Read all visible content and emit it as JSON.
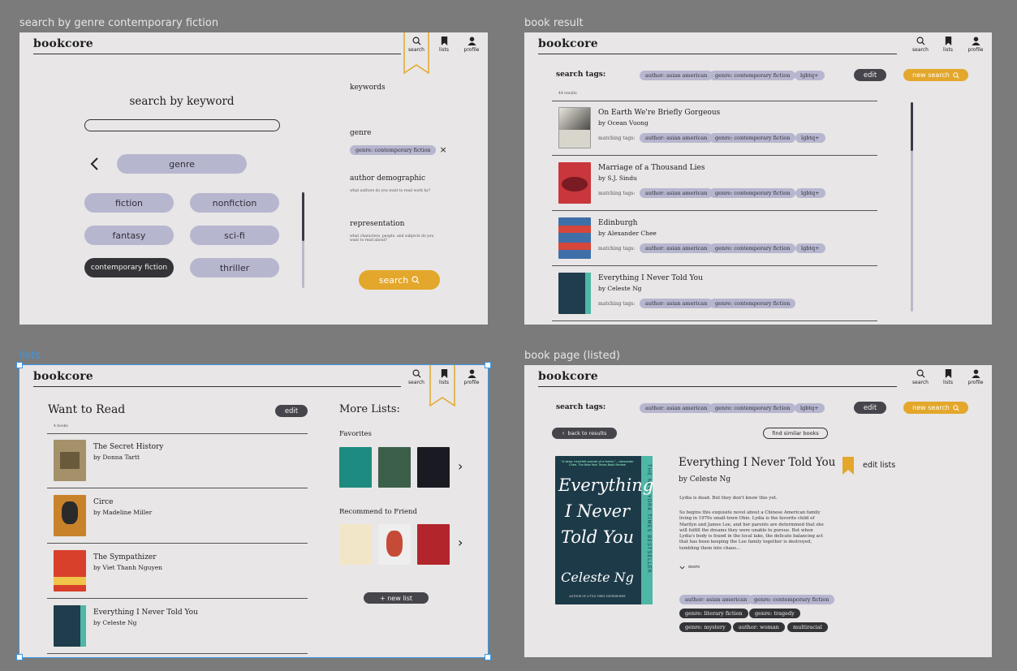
{
  "frames": {
    "search_genre_title": "search by genre contemporary fiction",
    "book_result_title": "book result",
    "lists_title": "lists",
    "book_page_title": "book page (listed)"
  },
  "app": {
    "logo": "bookcore"
  },
  "nav": {
    "search": "search",
    "lists": "lists",
    "profile": "profile"
  },
  "search_page": {
    "heading": "search by keyword",
    "genre_label": "genre",
    "genres": [
      "fiction",
      "nonfiction",
      "fantasy",
      "sci-fi",
      "contemporary fiction",
      "thriller"
    ],
    "selected_genre": "contemporary fiction",
    "keywords_label": "keywords",
    "genre_section_label": "genre",
    "genre_chip": "genre: contemporary fiction",
    "chip_remove": "×",
    "author_demo_label": "author demographic",
    "author_demo_hint": "what authors do you want to read work by?",
    "representation_label": "representation",
    "representation_hint": "what characters, people, and subjects do you want to read about?",
    "search_button": "search"
  },
  "results_page": {
    "search_tags_label": "search tags:",
    "tags": [
      "author: asian american",
      "genre: contemporary fiction",
      "lgbtq+"
    ],
    "edit": "edit",
    "new_search": "new search",
    "count": "44 results",
    "matching_label": "matching tags:",
    "books": [
      {
        "title": "On Earth We're Briefly Gorgeous",
        "author": "by Ocean Vuong",
        "tags": [
          "author: asian american",
          "genre: contemporary fiction",
          "lgbtq+"
        ],
        "color": "#d8d5cc"
      },
      {
        "title": "Marriage of a Thousand Lies",
        "author": "by S.J. Sindu",
        "tags": [
          "author: asian american",
          "genre: contemporary fiction",
          "lgbtq+"
        ],
        "color": "#c9363c"
      },
      {
        "title": "Edinburgh",
        "author": "by Alexander Chee",
        "tags": [
          "author: asian american",
          "genre: contemporary fiction",
          "lgbtq+"
        ],
        "color": "#3f6fa8"
      },
      {
        "title": "Everything I Never Told You",
        "author": "by Celeste Ng",
        "tags": [
          "author: asian american",
          "genre: contemporary fiction"
        ],
        "color": "#1f3d4c"
      }
    ]
  },
  "lists_page": {
    "title": "Want to Read",
    "edit": "edit",
    "count": "4 books",
    "books": [
      {
        "title": "The Secret History",
        "author": "by Donna Tartt",
        "color": "#a4916a"
      },
      {
        "title": "Circe",
        "author": "by Madeline Miller",
        "color": "#c8822a"
      },
      {
        "title": "The Sympathizer",
        "author": "by Viet Thanh Nguyen",
        "color": "#d8402b"
      },
      {
        "title": "Everything I Never Told You",
        "author": "by Celeste Ng",
        "color": "#1f3d4c"
      }
    ],
    "more_lists": "More Lists:",
    "favorites": "Favorites",
    "recommend": "Recommend to Friend",
    "new_list": "+ new list",
    "next": "›"
  },
  "book_page": {
    "search_tags_label": "search tags:",
    "tags": [
      "author: asian american",
      "genre: contemporary fiction",
      "lgbtq+"
    ],
    "edit": "edit",
    "new_search": "new search",
    "back": "back to results",
    "similar": "find similar books",
    "title": "Everything I Never Told You",
    "author": "by Celeste Ng",
    "edit_lists": "edit lists",
    "lead": "Lydia is dead. But they don't know this yet.",
    "blurb": "So begins this exquisite novel about a Chinese American family living in 1970s small-town Ohio. Lydia is the favorite child of Marilyn and James Lee, and her parents are determined that she will fulfill the dreams they were unable to pursue. But when Lydia's body is found in the local lake, the delicate balancing act that has been keeping the Lee family together is destroyed, tumbling them into chaos...",
    "more": "more",
    "book_tags": [
      {
        "label": "author: asian american",
        "dark": false
      },
      {
        "label": "genre: contemporary fiction",
        "dark": false
      },
      {
        "label": "genre: literary fiction",
        "dark": true
      },
      {
        "label": "genre: tragedy",
        "dark": true
      },
      {
        "label": "genre: mystery",
        "dark": true
      },
      {
        "label": "author: woman",
        "dark": true
      },
      {
        "label": "multiracial",
        "dark": true
      }
    ],
    "cover_text": "Everything I Never Told You",
    "cover_author": "Celeste Ng",
    "cover_side": "THE NEW YORK TIMES BESTSELLER",
    "cover_top": "\"A deep, heartfelt portrait of a family.\" —Alexander Chee, The New York Times Book Review",
    "cover_bottom": "AUTHOR OF LITTLE FIRES EVERYWHERE"
  },
  "colors": {
    "accent": "#e3a72c",
    "pill": "#b7b6cf",
    "dark": "#343438",
    "frame": "#e8e6e6",
    "canvas": "#7b7b7b"
  },
  "icons": [
    "search-icon",
    "bookmark-icon",
    "profile-icon",
    "chevron-left-icon",
    "chevron-right-icon",
    "close-icon",
    "chevron-down-icon"
  ]
}
